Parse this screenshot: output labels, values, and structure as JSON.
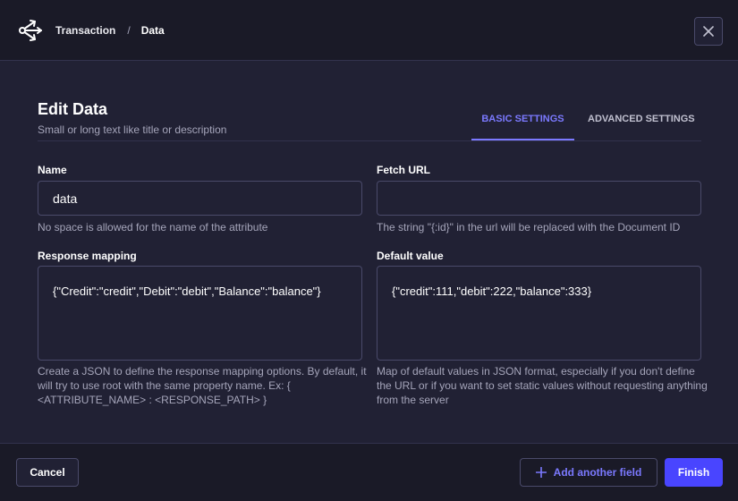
{
  "header": {
    "breadcrumb": [
      "Transaction",
      "Data"
    ],
    "separator": "/",
    "icon": "share-arrows-icon",
    "close_icon": "close-icon"
  },
  "form": {
    "title": "Edit Data",
    "subtitle": "Small or long text like title or description",
    "tabs": [
      {
        "label": "BASIC SETTINGS",
        "active": true
      },
      {
        "label": "ADVANCED SETTINGS",
        "active": false
      }
    ],
    "fields": {
      "name": {
        "label": "Name",
        "value": "data",
        "hint": "No space is allowed for the name of the attribute"
      },
      "fetch_url": {
        "label": "Fetch URL",
        "value": "",
        "hint": "The string \"{:id}\" in the url will be replaced with the Document ID"
      },
      "response_mapping": {
        "label": "Response mapping",
        "value": "{\"Credit\":\"credit\",\"Debit\":\"debit\",\"Balance\":\"balance\"}",
        "hint": "Create a JSON to define the response mapping options. By default, it will try to use root with the same property name. Ex: { <ATTRIBUTE_NAME> : <RESPONSE_PATH> }"
      },
      "default_value": {
        "label": "Default value",
        "value": "{\"credit\":111,\"debit\":222,\"balance\":333}",
        "hint": "Map of default values in JSON format, especially if you don't define the URL or if you want to set static values without requesting anything from the server"
      }
    }
  },
  "footer": {
    "cancel_label": "Cancel",
    "add_label": "Add another field",
    "finish_label": "Finish"
  },
  "colors": {
    "accent": "#7b79ff",
    "primary_button": "#4945ff",
    "background": "#212134",
    "header_background": "#1a1a27"
  }
}
